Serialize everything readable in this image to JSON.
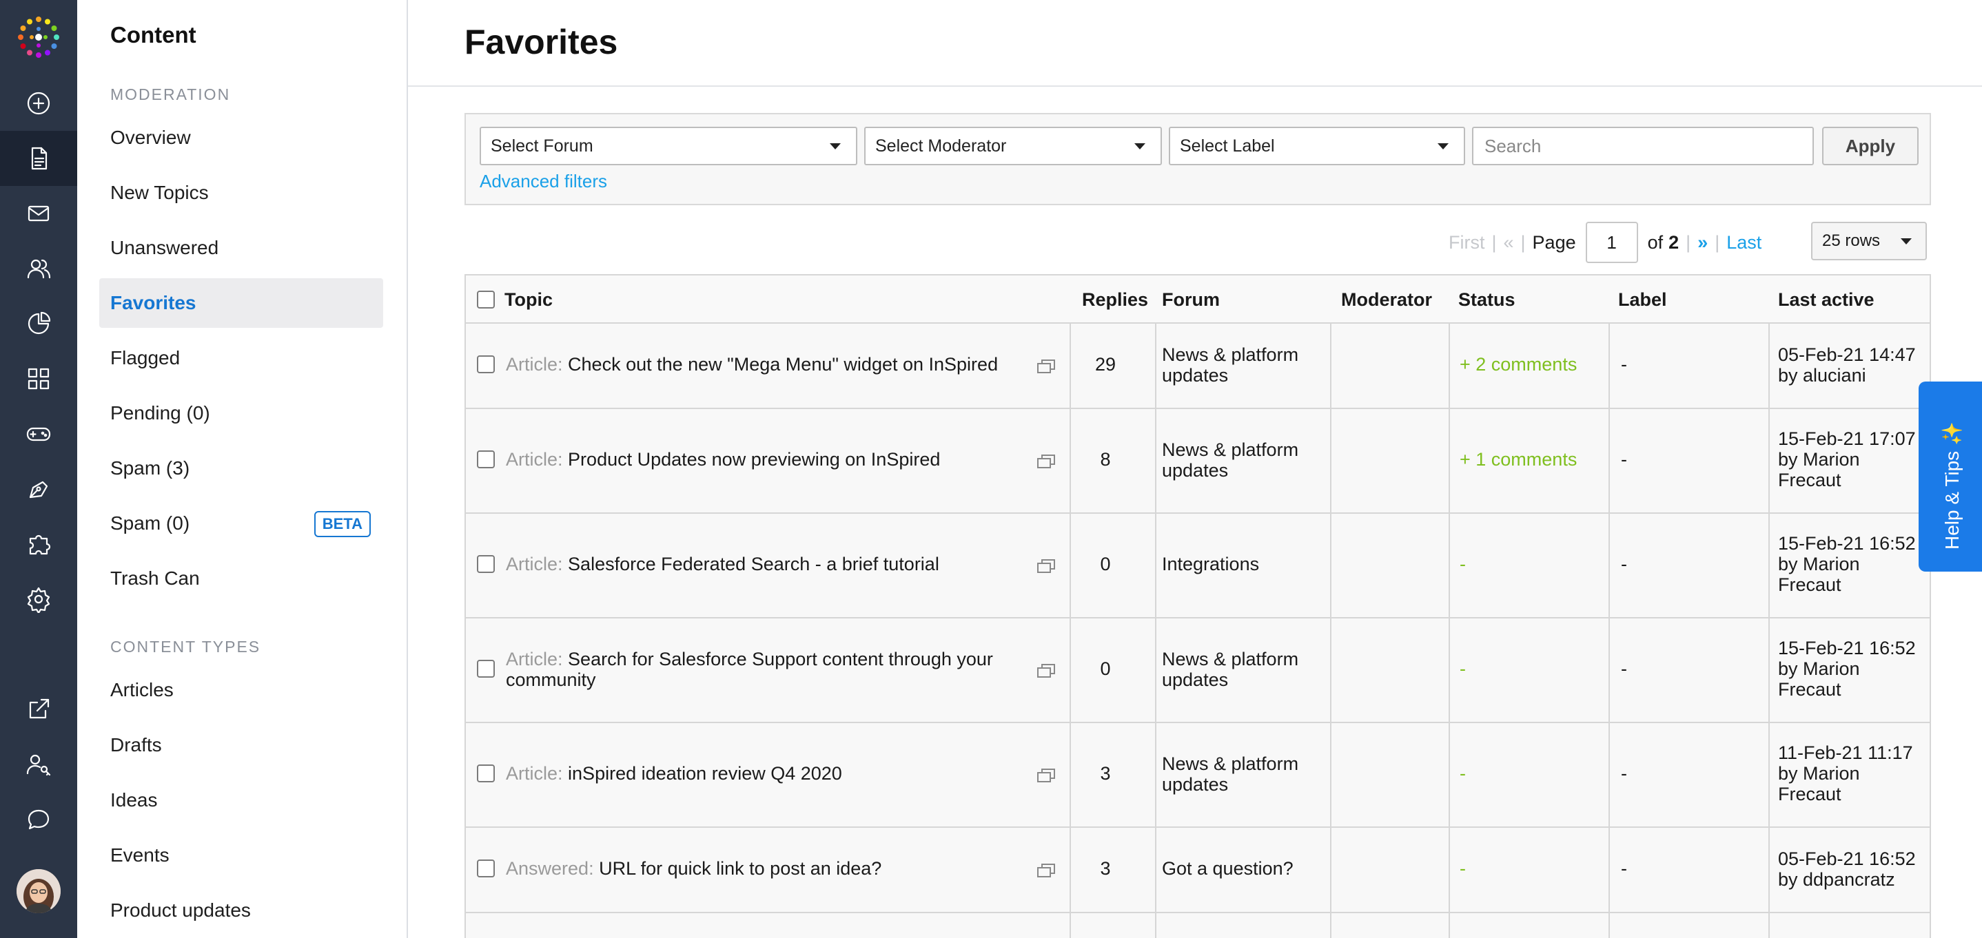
{
  "sidebar": {
    "title": "Content",
    "sections": [
      {
        "label": "MODERATION",
        "items": [
          {
            "label": "Overview"
          },
          {
            "label": "New Topics"
          },
          {
            "label": "Unanswered"
          },
          {
            "label": "Favorites",
            "active": true
          },
          {
            "label": "Flagged"
          },
          {
            "label": "Pending (0)"
          },
          {
            "label": "Spam (3)"
          },
          {
            "label": "Spam (0)",
            "badge": "BETA"
          },
          {
            "label": "Trash Can"
          }
        ]
      },
      {
        "label": "CONTENT TYPES",
        "items": [
          {
            "label": "Articles"
          },
          {
            "label": "Drafts"
          },
          {
            "label": "Ideas"
          },
          {
            "label": "Events"
          },
          {
            "label": "Product updates"
          }
        ]
      }
    ]
  },
  "rail": {
    "icons": [
      "plus-circle-icon",
      "document-icon",
      "mail-icon",
      "users-icon",
      "pie-chart-icon",
      "grid-icon",
      "gamepad-icon",
      "pen-icon",
      "puzzle-icon",
      "gear-icon",
      "external-link-icon",
      "user-key-icon",
      "chat-icon"
    ]
  },
  "page": {
    "title": "Favorites"
  },
  "filters": {
    "forum": "Select Forum",
    "moderator": "Select Moderator",
    "label": "Select Label",
    "search_placeholder": "Search",
    "apply": "Apply",
    "advanced": "Advanced filters"
  },
  "pager": {
    "first": "First",
    "prev": "«",
    "page_label": "Page",
    "current": "1",
    "of": "of",
    "total": "2",
    "next": "»",
    "last": "Last",
    "rows": "25 rows"
  },
  "table": {
    "headers": {
      "topic": "Topic",
      "replies": "Replies",
      "forum": "Forum",
      "moderator": "Moderator",
      "status": "Status",
      "label": "Label",
      "last_active": "Last active"
    },
    "rows": [
      {
        "kind": "Article:",
        "title": "Check out the new \"Mega Menu\" widget on InSpired",
        "replies": "29",
        "forum": "News & platform updates",
        "moderator": "",
        "status": "+ 2 comments",
        "label": "-",
        "date": "05-Feb-21 14:47",
        "by": "by aluciani"
      },
      {
        "kind": "Article:",
        "title": "Product Updates now previewing on InSpired",
        "replies": "8",
        "forum": "News & platform updates",
        "moderator": "",
        "status": "+ 1 comments",
        "label": "-",
        "date": "15-Feb-21 17:07",
        "by": "by Marion Frecaut"
      },
      {
        "kind": "Article:",
        "title": "Salesforce Federated Search - a brief tutorial",
        "replies": "0",
        "forum": "Integrations",
        "moderator": "",
        "status": "-",
        "label": "-",
        "date": "15-Feb-21 16:52",
        "by": "by Marion Frecaut"
      },
      {
        "kind": "Article:",
        "title": "Search for Salesforce Support content through your community",
        "replies": "0",
        "forum": "News & platform updates",
        "moderator": "",
        "status": "-",
        "label": "-",
        "date": "15-Feb-21 16:52",
        "by": "by Marion Frecaut"
      },
      {
        "kind": "Article:",
        "title": "inSpired ideation review Q4 2020",
        "replies": "3",
        "forum": "News & platform updates",
        "moderator": "",
        "status": "-",
        "label": "-",
        "date": "11-Feb-21 11:17",
        "by": "by Marion Frecaut"
      },
      {
        "kind": "Answered:",
        "title": "URL for quick link to post an idea?",
        "replies": "3",
        "forum": "Got a question?",
        "moderator": "",
        "status": "-",
        "label": "-",
        "date": "05-Feb-21 16:52",
        "by": "by ddpancratz"
      }
    ]
  },
  "help": {
    "label": "Help & Tips ✨"
  },
  "colors": {
    "accent": "#1677d2",
    "link": "#1aa0e8",
    "status_green": "#7fbf1f",
    "rail": "#2b3546"
  }
}
